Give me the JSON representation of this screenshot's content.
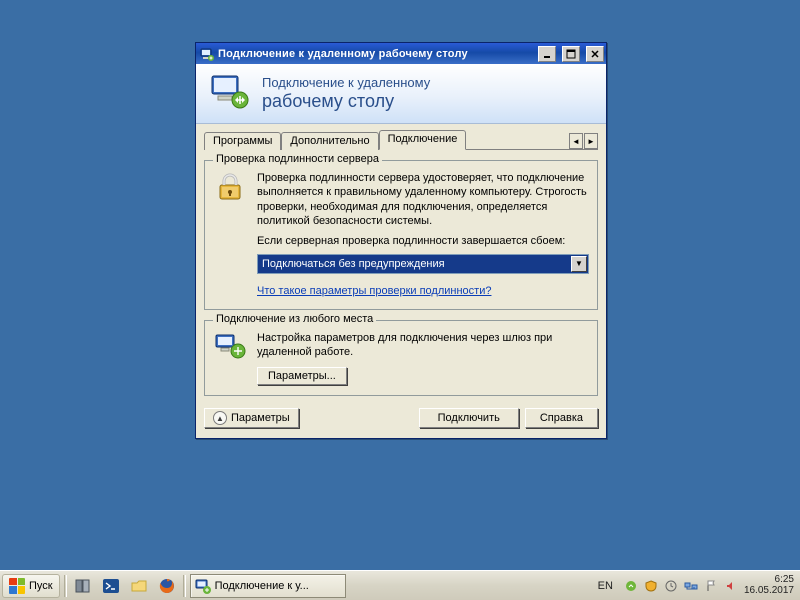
{
  "window": {
    "title": "Подключение к удаленному рабочему столу"
  },
  "banner": {
    "line1": "Подключение к удаленному",
    "line2": "рабочему столу"
  },
  "tabs": {
    "programs": "Программы",
    "advanced": "Дополнительно",
    "connection": "Подключение"
  },
  "group_auth": {
    "title": "Проверка подлинности сервера",
    "desc": "Проверка подлинности сервера удостоверяет, что подключение выполняется к правильному удаленному компьютеру. Строгость проверки, необходимая для подключения, определяется политикой безопасности системы.",
    "prompt": "Если серверная проверка подлинности завершается сбоем:",
    "select_value": "Подключаться без предупреждения",
    "link": "Что такое параметры проверки подлинности?"
  },
  "group_anywhere": {
    "title": "Подключение из любого места",
    "desc": "Настройка параметров для подключения через шлюз при удаленной работе.",
    "button": "Параметры..."
  },
  "footer": {
    "options": "Параметры",
    "connect": "Подключить",
    "help": "Справка"
  },
  "taskbar": {
    "start": "Пуск",
    "task_label": "Подключение к у...",
    "lang": "EN",
    "time": "6:25",
    "date": "16.05.2017"
  }
}
